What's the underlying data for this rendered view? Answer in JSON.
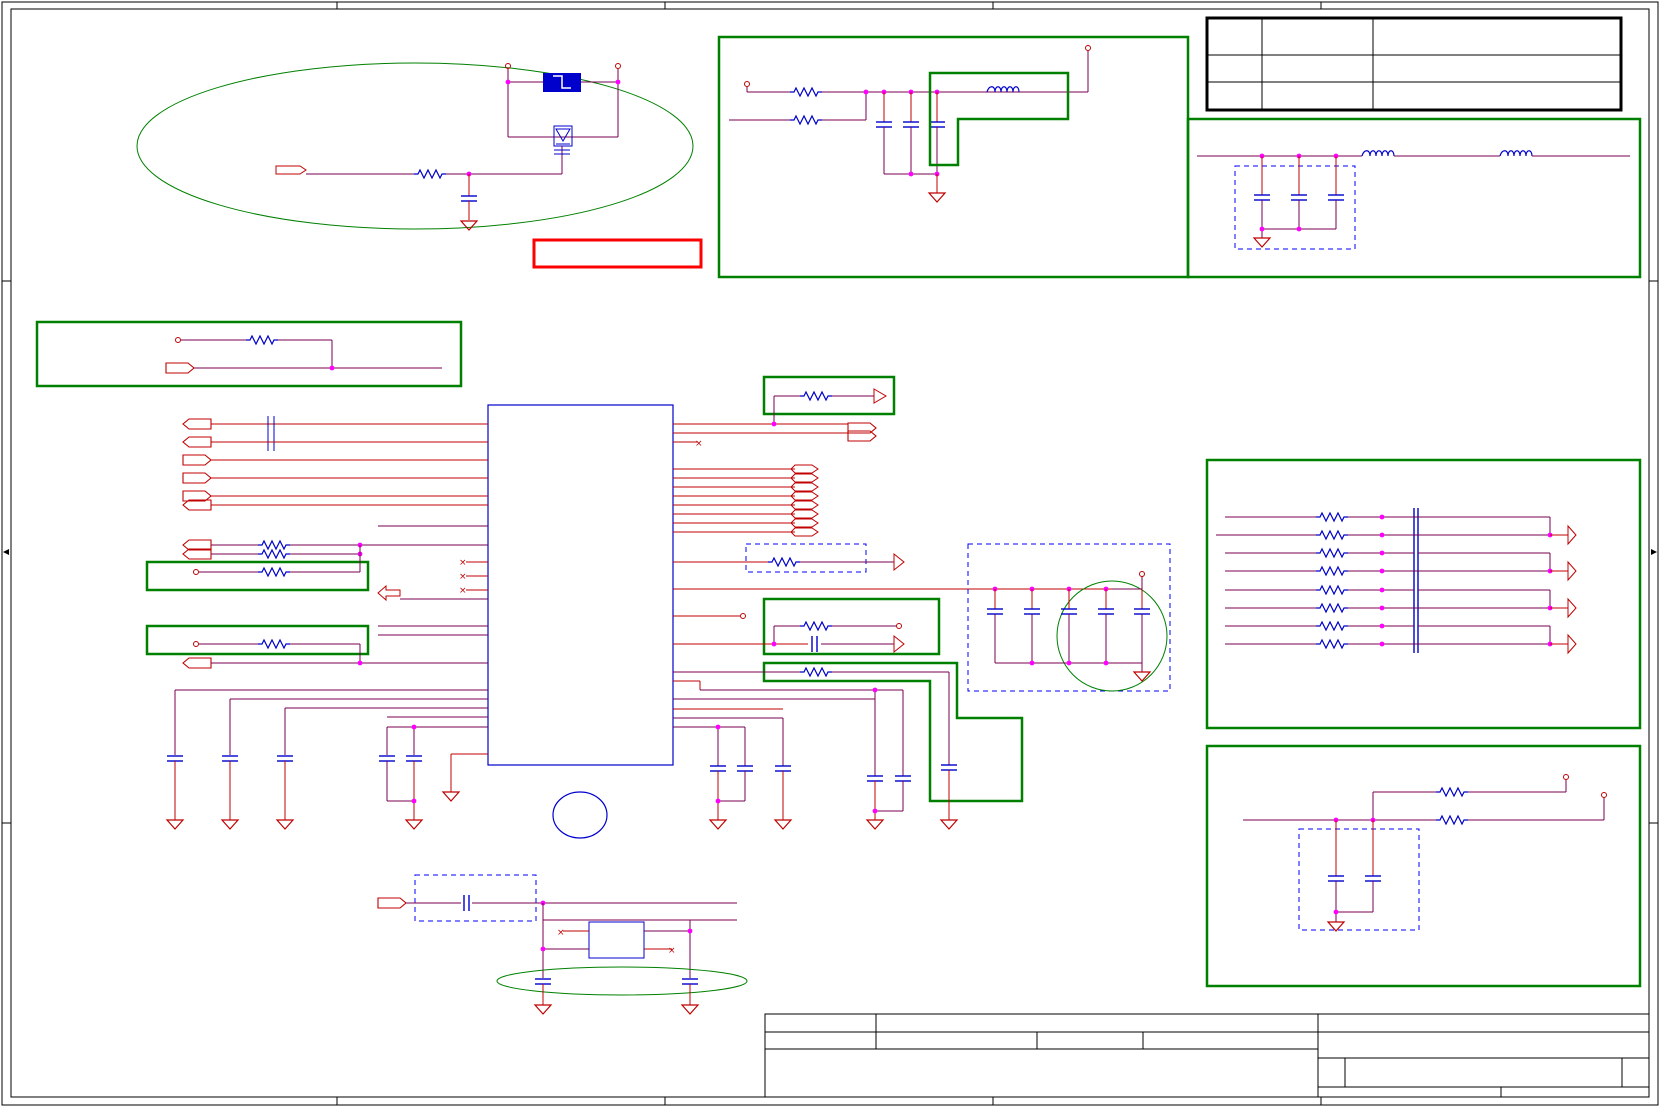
{
  "sheet": {
    "description_note": "",
    "colors": {
      "wire": "#c00000",
      "net": "#7a0050",
      "component": "#0000cc",
      "junction": "#ff00ff",
      "group_box": "#008000",
      "dashed_box": "#0000ff",
      "highlight_box": "#ff0000",
      "frame": "#000000"
    },
    "icons": [
      "resistor-icon",
      "capacitor-icon",
      "inductor-icon",
      "ground-icon",
      "port-icon",
      "junction-dot-icon",
      "no-connect-icon",
      "diode-icon",
      "fuse-icon"
    ]
  }
}
